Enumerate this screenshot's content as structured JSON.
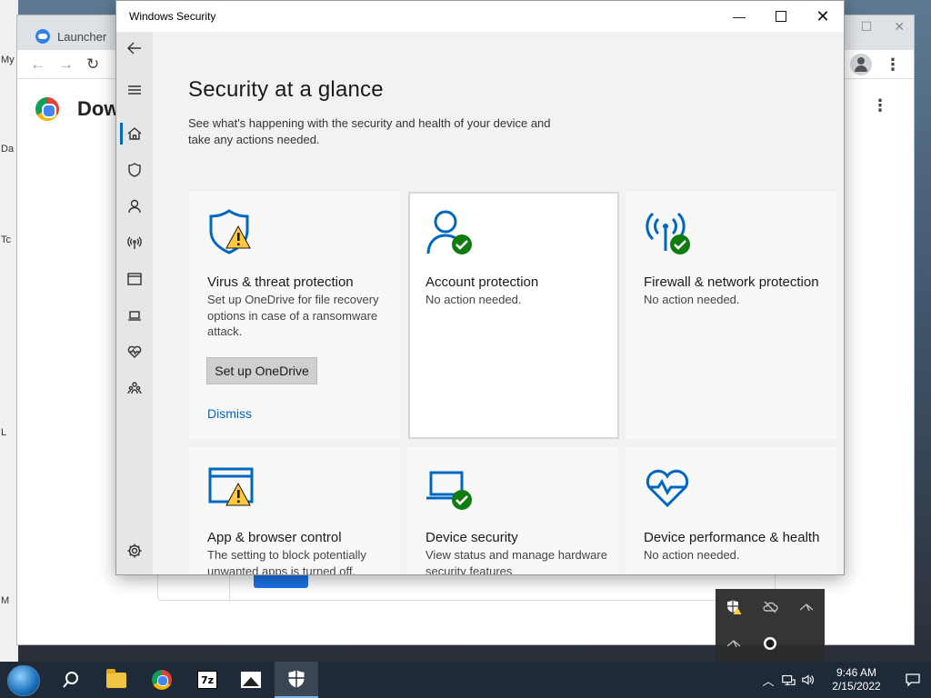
{
  "desktop": {
    "edge_labels": [
      "My",
      "Da",
      "Tc",
      "L",
      "M"
    ]
  },
  "chrome": {
    "tab_title": "Launcher",
    "page_heading": "Dow"
  },
  "window": {
    "title": "Windows Security"
  },
  "sidebar": {
    "items": [
      {
        "name": "back",
        "icon": "back-arrow-icon"
      },
      {
        "name": "menu",
        "icon": "hamburger-icon"
      },
      {
        "name": "home",
        "icon": "home-icon",
        "active": true
      },
      {
        "name": "virus-protection",
        "icon": "shield-icon"
      },
      {
        "name": "account-protection",
        "icon": "person-icon"
      },
      {
        "name": "firewall",
        "icon": "antenna-icon"
      },
      {
        "name": "app-browser",
        "icon": "browser-window-icon"
      },
      {
        "name": "device-security",
        "icon": "laptop-icon"
      },
      {
        "name": "device-health",
        "icon": "heart-icon"
      },
      {
        "name": "family",
        "icon": "family-icon"
      },
      {
        "name": "settings",
        "icon": "gear-icon"
      }
    ]
  },
  "main": {
    "title": "Security at a glance",
    "subtitle": "See what's happening with the security and health of your device and take any actions needed.",
    "tiles": [
      {
        "title": "Virus & threat protection",
        "desc": "Set up OneDrive for file recovery options in case of a ransomware attack.",
        "status": "warning",
        "button": "Set up OneDrive",
        "link": "Dismiss"
      },
      {
        "title": "Account protection",
        "desc": "No action needed.",
        "status": "ok"
      },
      {
        "title": "Firewall & network protection",
        "desc": "No action needed.",
        "status": "ok"
      },
      {
        "title": "App & browser control",
        "desc": "The setting to block potentially unwanted apps is turned off.",
        "status": "warning"
      },
      {
        "title": "Device security",
        "desc": "View status and manage hardware security features",
        "status": "ok"
      },
      {
        "title": "Device performance & health",
        "desc": "No action needed.",
        "status": "ok"
      }
    ]
  },
  "colors": {
    "accent": "#0067c0",
    "ok": "#107c10",
    "warning": "#ffc83d"
  },
  "taskbar": {
    "time": "9:46 AM",
    "date": "2/15/2022",
    "apps": [
      "file-explorer",
      "chrome",
      "7-zip",
      "photos",
      "windows-security"
    ],
    "sevenzip_label": "7z"
  }
}
